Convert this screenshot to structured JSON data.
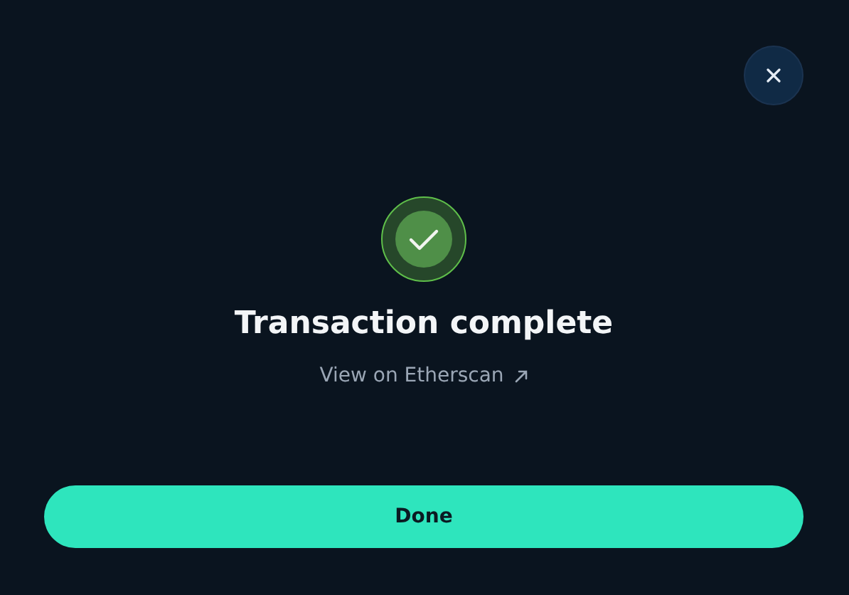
{
  "title": "Transaction complete",
  "link": {
    "label": "View on Etherscan"
  },
  "primary_button": {
    "label": "Done"
  }
}
